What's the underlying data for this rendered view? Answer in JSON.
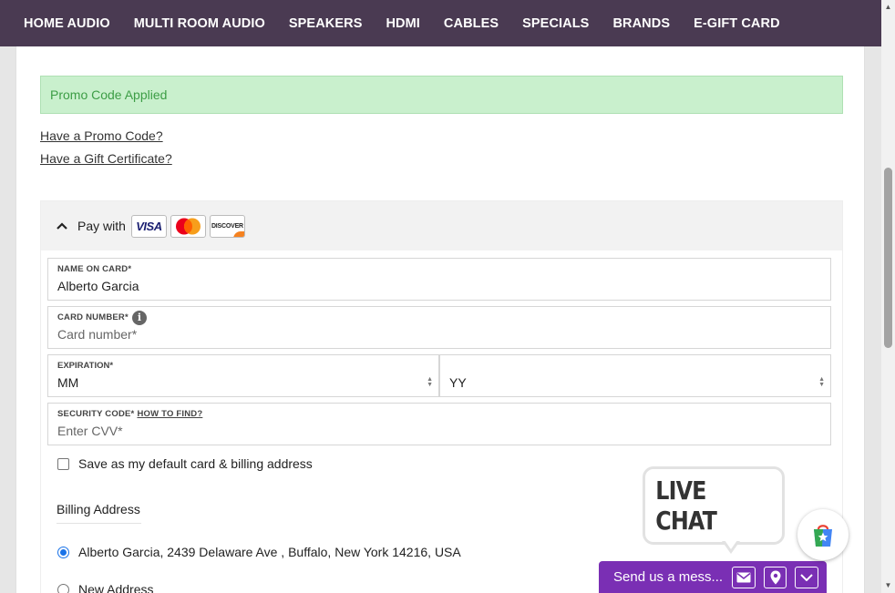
{
  "nav": {
    "items": [
      "HOME AUDIO",
      "MULTI ROOM AUDIO",
      "SPEAKERS",
      "HDMI",
      "CABLES",
      "SPECIALS",
      "BRANDS",
      "E-GIFT CARD"
    ]
  },
  "promo": {
    "applied_text": "Promo Code Applied",
    "have_promo": "Have a Promo Code?",
    "have_gift": "Have a Gift Certificate?"
  },
  "payment": {
    "pay_with": "Pay with",
    "card_logos": {
      "visa": "VISA",
      "mastercard": "MasterCard",
      "discover": "DISCOVER"
    },
    "name_label": "NAME ON CARD*",
    "name_value": "Alberto Garcia",
    "card_label": "CARD NUMBER*",
    "card_placeholder": "Card number*",
    "exp_label": "EXPIRATION*",
    "exp_month": "MM",
    "exp_year": "YY",
    "cvv_label": "SECURITY CODE*",
    "cvv_howto": "HOW TO FIND?",
    "cvv_placeholder": "Enter CVV*",
    "save_default": "Save as my default card & billing address"
  },
  "billing": {
    "title": "Billing Address",
    "address_1": "Alberto Garcia, 2439 Delaware Ave , Buffalo, New York 14216, USA",
    "address_new": "New Address"
  },
  "chat": {
    "bubble": "LIVE CHAT",
    "send_text": "Send us a mess..."
  },
  "colors": {
    "nav_bg": "#4a3a52",
    "promo_bg": "#c9f0cd",
    "promo_text": "#3c9d45",
    "chat_purple": "#7a2fb4",
    "radio_blue": "#1a73e8"
  }
}
